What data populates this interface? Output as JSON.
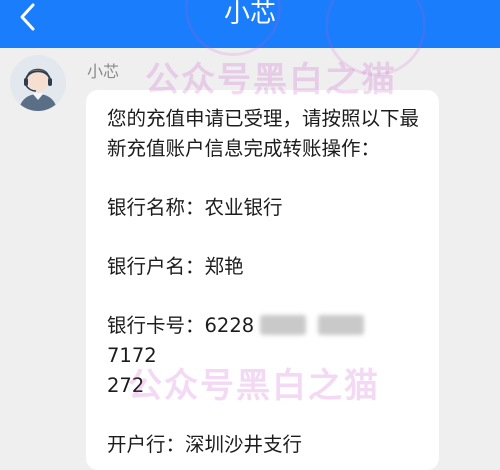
{
  "titlebar": {
    "title": "小芯"
  },
  "message": {
    "sender": "小芯",
    "line1": "您的充值申请已受理，请按照以下最新充值账户信息完成转账操作：",
    "bank_name": "银行名称：农业银行",
    "account_name": "银行户名：郑艳",
    "card_label": "银行卡号：",
    "card_start": "6228",
    "card_end": "7172",
    "card_tail": "272",
    "branch": "开户行：深圳沙井支行"
  },
  "watermark": {
    "text": "公众号黑白之猫"
  },
  "colors": {
    "header": "#1a7dfb",
    "background": "#efefef",
    "bubble": "#ffffff"
  }
}
